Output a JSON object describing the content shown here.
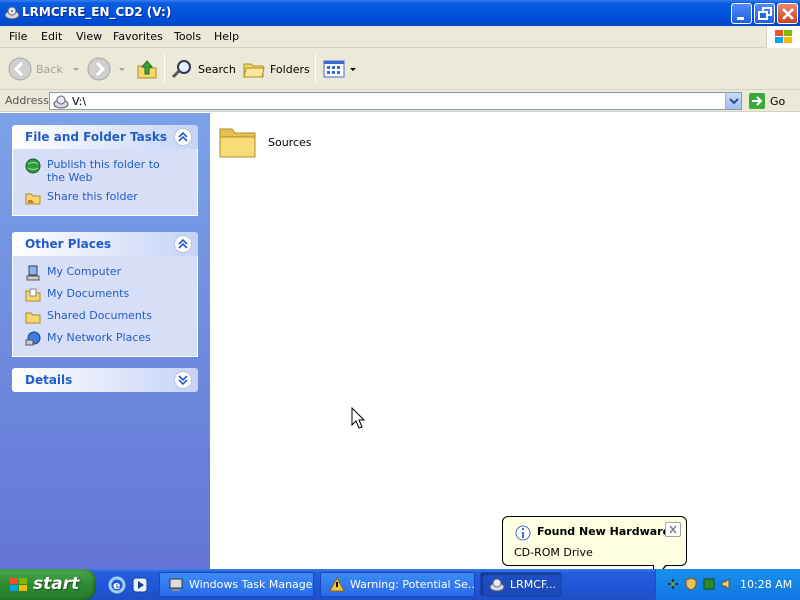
{
  "window": {
    "title": "LRMCFRE_EN_CD2 (V:)",
    "controls": {
      "minimize": "minimize",
      "maximize": "maximize",
      "close": "close"
    }
  },
  "menu": [
    "File",
    "Edit",
    "View",
    "Favorites",
    "Tools",
    "Help"
  ],
  "toolbar": {
    "back": "Back",
    "search": "Search",
    "folders": "Folders"
  },
  "address": {
    "label": "Address",
    "value": "V:\\",
    "go": "Go"
  },
  "sidebar": {
    "tasks": {
      "title": "File and Folder Tasks",
      "items": [
        {
          "label": "Publish this folder to the Web",
          "icon": "globe-publish-icon"
        },
        {
          "label": "Share this folder",
          "icon": "share-folder-icon"
        }
      ]
    },
    "places": {
      "title": "Other Places",
      "items": [
        {
          "label": "My Computer",
          "icon": "my-computer-icon"
        },
        {
          "label": "My Documents",
          "icon": "my-documents-icon"
        },
        {
          "label": "Shared Documents",
          "icon": "shared-documents-icon"
        },
        {
          "label": "My Network Places",
          "icon": "network-places-icon"
        }
      ]
    },
    "details": {
      "title": "Details"
    }
  },
  "content": {
    "items": [
      {
        "name": "Sources",
        "icon": "folder-icon"
      }
    ]
  },
  "balloon": {
    "title": "Found New Hardware",
    "text": "CD-ROM Drive"
  },
  "taskbar": {
    "start": "start",
    "tasks": [
      {
        "label": "Windows Task Manager",
        "icon": "task-manager-icon",
        "active": false
      },
      {
        "label": "Warning: Potential Se...",
        "icon": "warning-icon",
        "active": false
      },
      {
        "label": "LRMCF...",
        "icon": "cd-drive-icon",
        "active": true
      }
    ],
    "clock": "10:28 AM"
  },
  "colors": {
    "title_bar": "#0050dc",
    "sidebar_link": "#215dc6",
    "taskbar": "#2157d8",
    "start_button": "#2f8b33"
  }
}
